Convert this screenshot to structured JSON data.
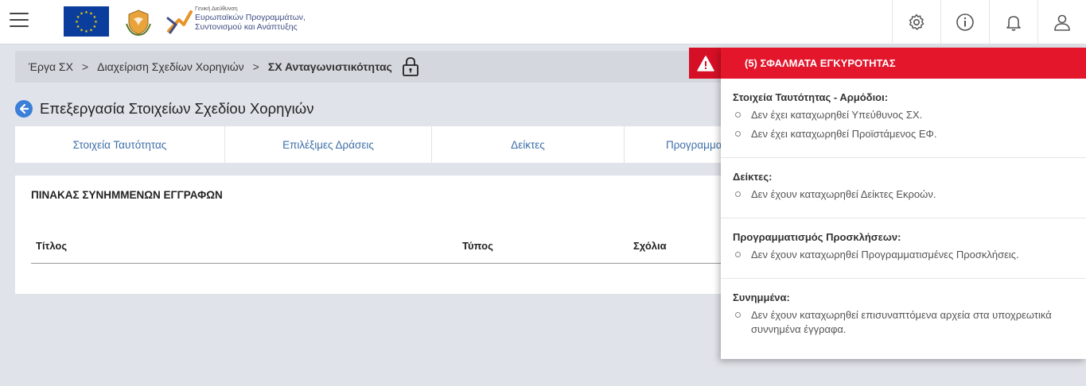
{
  "header": {
    "agency_small": "Γενική Διεύθυνση",
    "agency_line1": "Ευρωπαϊκών Προγραμμάτων,",
    "agency_line2": "Συντονισμού και Ανάπτυξης",
    "icons": [
      "menu-icon",
      "settings-gear-icon",
      "info-icon",
      "bell-icon",
      "user-icon"
    ]
  },
  "breadcrumb": {
    "items": [
      "Έργα ΣΧ",
      "Διαχείριση Σχεδίων Χορηγιών",
      "ΣΧ Ανταγωνιστικότητας"
    ],
    "separator": ">"
  },
  "page": {
    "title": "Επεξεργασία Στοιχείων Σχεδίου Χορηγιών"
  },
  "tabs": [
    "Στοιχεία Ταυτότητας",
    "Επιλέξιμες Δράσεις",
    "Δείκτες",
    "Προγραμματ"
  ],
  "documents": {
    "title": "ΠΙΝΑΚΑΣ ΣΥΝΗΜΜΕΝΩΝ ΕΓΓΡΑΦΩΝ",
    "columns": [
      "Τίτλος",
      "Τύπος",
      "Σχόλια"
    ],
    "rows": []
  },
  "errors": {
    "header": "(5) ΣΦΑΛΜΑΤΑ ΕΓΚΥΡΟΤΗΤΑΣ",
    "sections": [
      {
        "title": "Στοιχεία Ταυτότητας - Αρμόδιοι:",
        "items": [
          "Δεν έχει καταχωρηθεί Υπεύθυνος ΣΧ.",
          "Δεν έχει καταχωρηθεί Προϊστάμενος ΕΦ."
        ]
      },
      {
        "title": "Δείκτες:",
        "items": [
          "Δεν έχουν καταχωρηθεί Δείκτες Εκροών."
        ]
      },
      {
        "title": "Προγραμματισμός Προσκλήσεων:",
        "items": [
          "Δεν έχουν καταχωρηθεί Προγραμματισμένες Προσκλήσεις."
        ]
      },
      {
        "title": "Συνημμένα:",
        "items": [
          "Δεν έχουν καταχωρηθεί επισυναπτόμενα αρχεία στα υποχρεωτικά συννημένα έγγραφα."
        ]
      }
    ]
  },
  "colors": {
    "accent_blue": "#3b7fd9",
    "error_red": "#e3162c",
    "tab_text": "#3d6ea8",
    "background": "#e1e3ea"
  }
}
